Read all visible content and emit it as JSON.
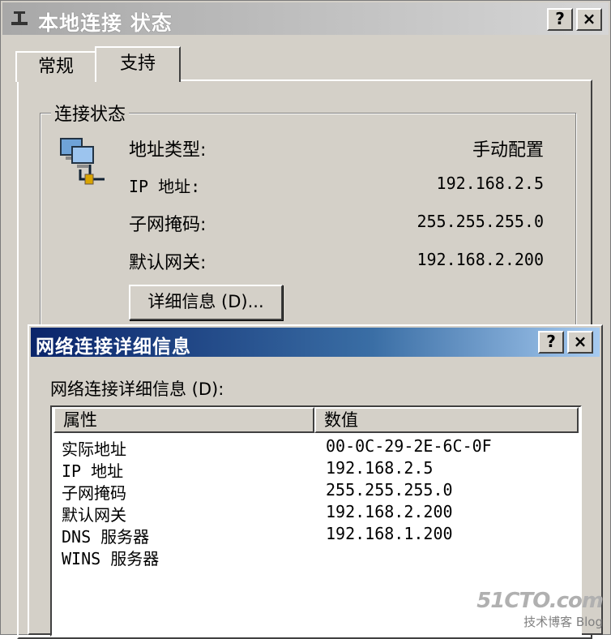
{
  "window": {
    "title": "本地连接 状态",
    "help_button": "?",
    "close_button": "×"
  },
  "tabs": [
    {
      "label": "常规"
    },
    {
      "label": "支持"
    }
  ],
  "connection_status": {
    "group_label": "连接状态",
    "rows": [
      {
        "label": "地址类型:",
        "value": "手动配置"
      },
      {
        "label": "IP 地址:",
        "value": "192.168.2.5"
      },
      {
        "label": "子网掩码:",
        "value": "255.255.255.0"
      },
      {
        "label": "默认网关:",
        "value": "192.168.2.200"
      }
    ],
    "details_button": "详细信息 (D)..."
  },
  "details_dialog": {
    "title": "网络连接详细信息",
    "help_button": "?",
    "close_button": "×",
    "prompt": "网络连接详细信息 (D):",
    "columns": [
      "属性",
      "数值"
    ],
    "rows": [
      {
        "property": "实际地址",
        "value": "00-0C-29-2E-6C-0F"
      },
      {
        "property": "IP 地址",
        "value": "192.168.2.5"
      },
      {
        "property": "子网掩码",
        "value": "255.255.255.0"
      },
      {
        "property": "默认网关",
        "value": "192.168.2.200"
      },
      {
        "property": "DNS 服务器",
        "value": "192.168.1.200"
      },
      {
        "property": "WINS 服务器",
        "value": ""
      }
    ]
  },
  "watermark": {
    "line1": "51CTO.com",
    "line2": "技术博客 Blog"
  }
}
